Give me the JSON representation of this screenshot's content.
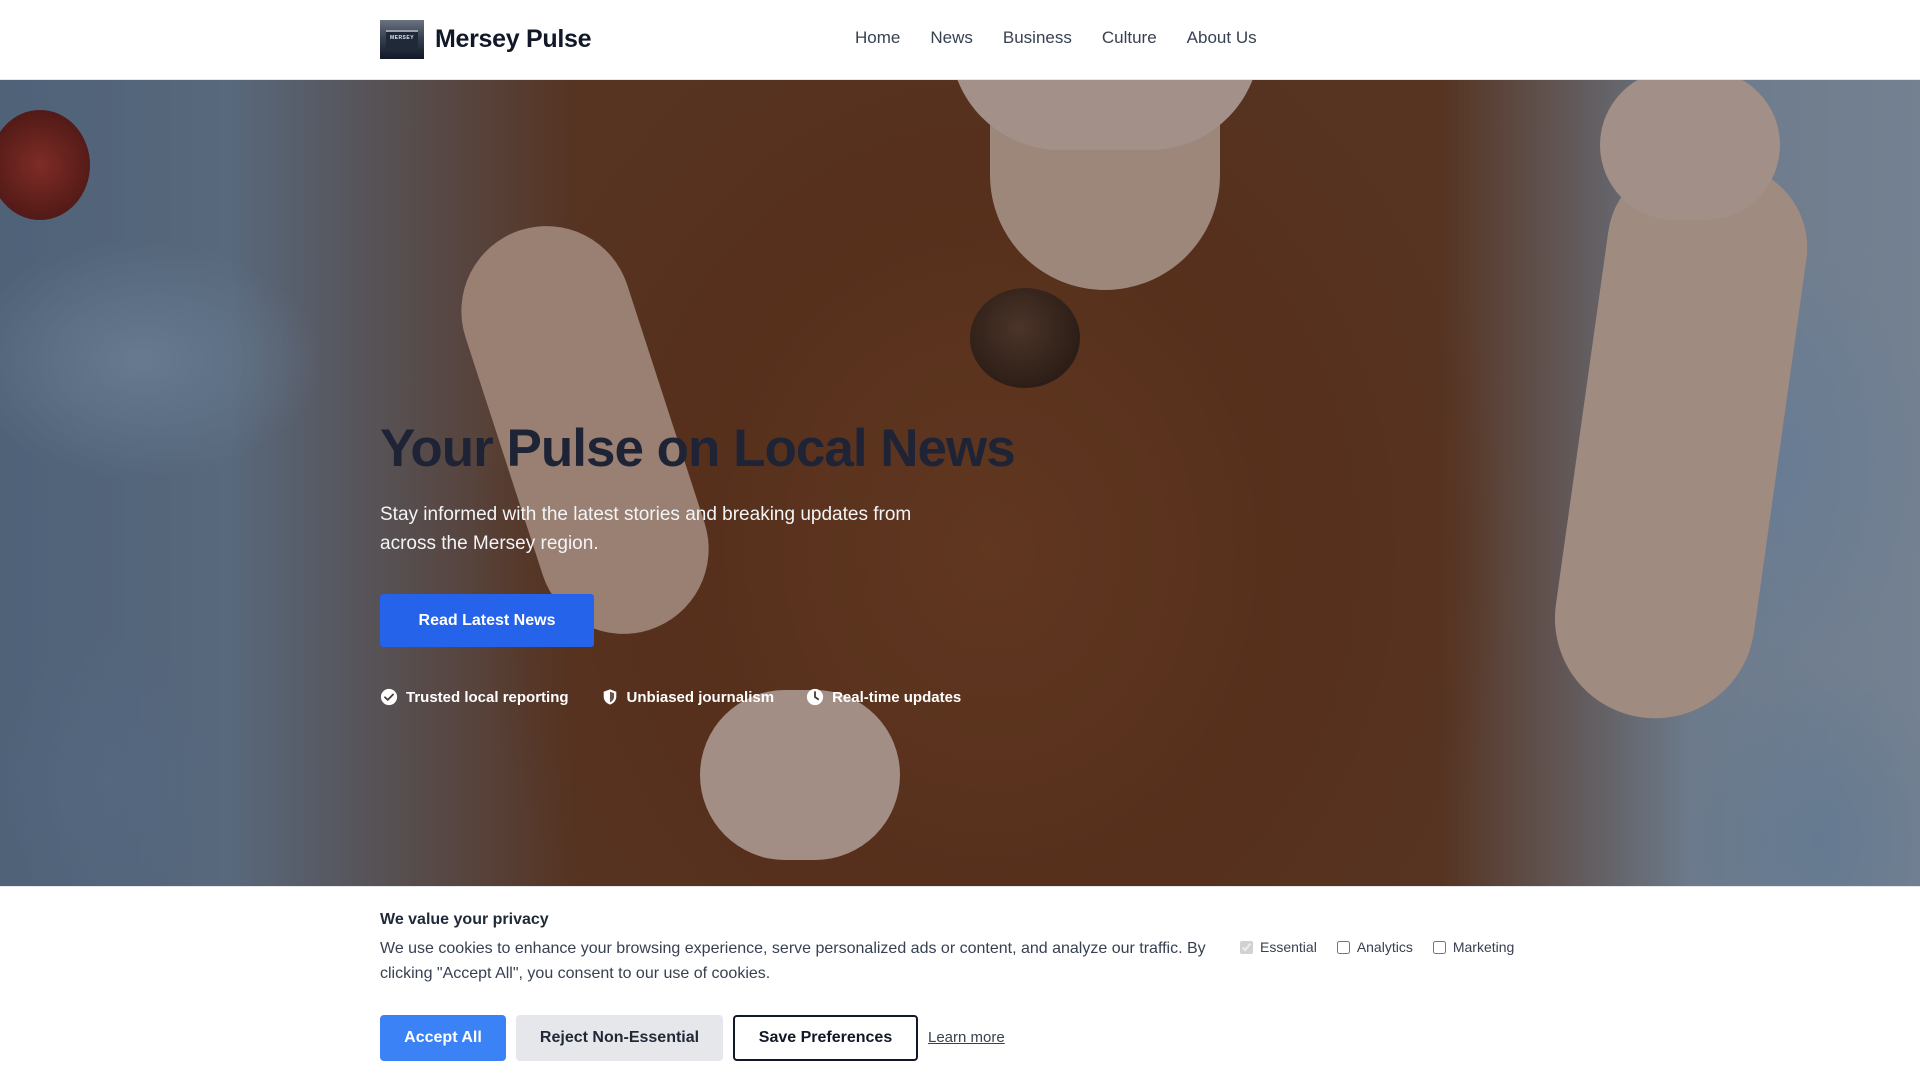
{
  "header": {
    "logo_text": "MERSEY",
    "brand": "Mersey Pulse",
    "nav": [
      "Home",
      "News",
      "Business",
      "Culture",
      "About Us"
    ]
  },
  "hero": {
    "title": "Your Pulse on Local News",
    "subtitle": "Stay informed with the latest stories and breaking updates from across the Mersey region.",
    "cta_label": "Read Latest News",
    "features": [
      {
        "icon": "check-circle-icon",
        "label": "Trusted local reporting"
      },
      {
        "icon": "shield-icon",
        "label": "Unbiased journalism"
      },
      {
        "icon": "clock-icon",
        "label": "Real-time updates"
      }
    ]
  },
  "cookie_banner": {
    "title": "We value your privacy",
    "text": "We use cookies to enhance your browsing experience, serve personalized ads or content, and analyze our traffic. By clicking \"Accept All\", you consent to our use of cookies.",
    "options": [
      {
        "label": "Essential",
        "checked": true,
        "disabled": true
      },
      {
        "label": "Analytics",
        "checked": false,
        "disabled": false
      },
      {
        "label": "Marketing",
        "checked": false,
        "disabled": false
      }
    ],
    "accept_label": "Accept All",
    "reject_label": "Reject Non-Essential",
    "save_label": "Save Preferences",
    "learn_more_label": "Learn more"
  },
  "colors": {
    "primary": "#2563eb",
    "accept": "#3b82f6",
    "hero_title": "#1e2436"
  }
}
